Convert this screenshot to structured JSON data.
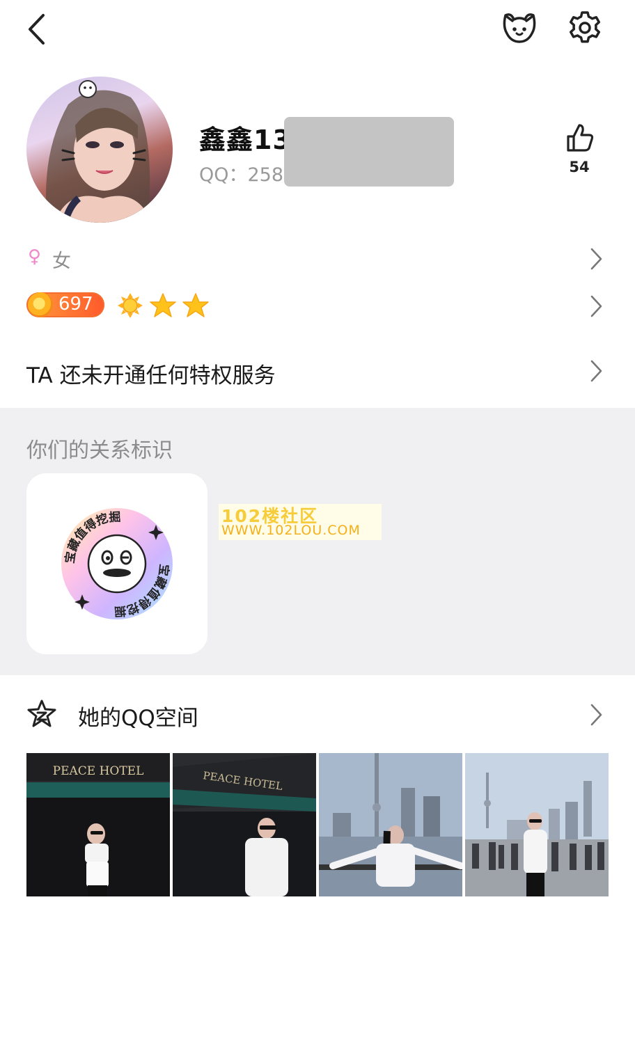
{
  "header": {
    "back_icon": "chevron-left-icon",
    "friend_icon": "cat-face-icon",
    "settings_icon": "gear-icon"
  },
  "profile": {
    "nickname": "鑫鑫134",
    "qq_label": "QQ：258",
    "like_count": "54",
    "like_icon": "thumbs-up-icon"
  },
  "info": {
    "gender_icon": "♀",
    "gender": "女",
    "level_value": "697",
    "privilege_text": "TA 还未开通任何特权服务"
  },
  "relation": {
    "title": "你们的关系标识",
    "badge_text": "宝藏值得挖掘",
    "watermark_title": "102楼社区",
    "watermark_url": "WWW.102LOU.COM"
  },
  "qzone": {
    "title": "她的QQ空间",
    "photo1_sign": "PEACE HOTEL",
    "photo2_sign": "PEACE HOTEL"
  },
  "colors": {
    "gender_pink": "#f089c9",
    "level_orange": "#ff6a2d",
    "star_yellow": "#ffc21a",
    "section_gray": "#f0f0f2"
  }
}
